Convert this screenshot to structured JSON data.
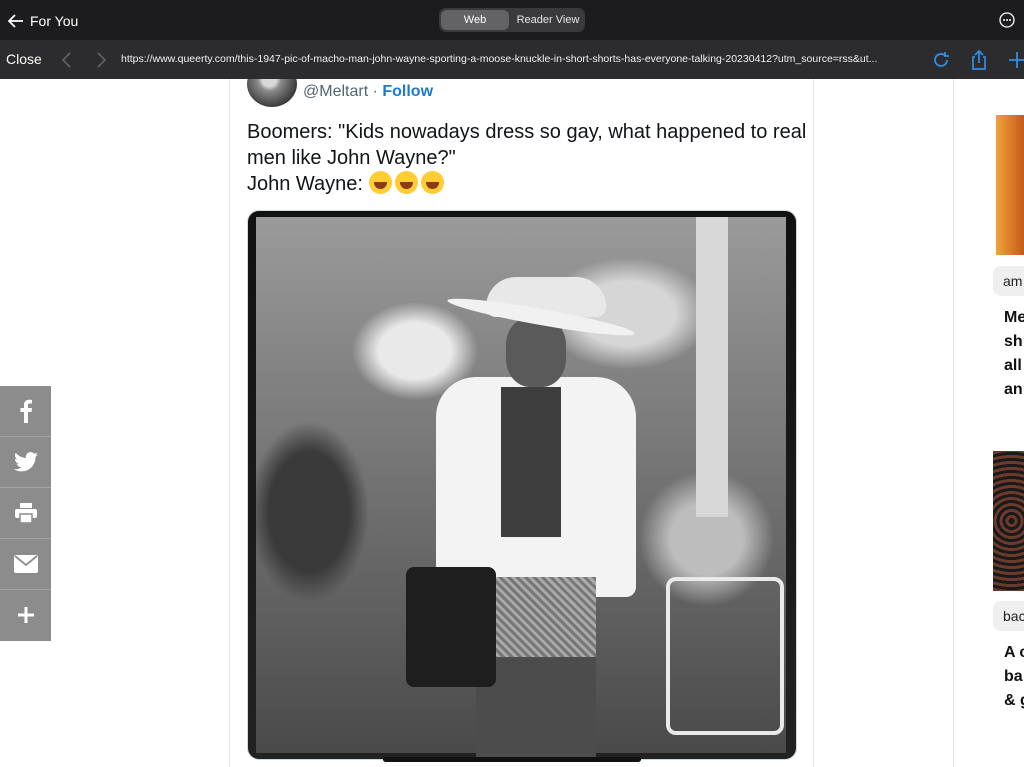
{
  "topbar": {
    "back_label": "For You",
    "segment": {
      "web": "Web",
      "reader": "Reader View",
      "selected": "Web"
    }
  },
  "address": {
    "close_label": "Close",
    "url": "https://www.queerty.com/this-1947-pic-of-macho-man-john-wayne-sporting-a-moose-knuckle-in-short-shorts-has-everyone-talking-20230412?utm_source=rss&ut..."
  },
  "tweet": {
    "handle": "@Meltart",
    "separator": " · ",
    "follow_label": "Follow",
    "line1": "Boomers: \"Kids nowadays dress so gay, what happened to real men like John Wayne?\"",
    "line2": "John Wayne:"
  },
  "sidebar_right": {
    "tag1": "am",
    "headline1": "Me\nsh\nall\nan",
    "tag2": "bac",
    "headline2": "A c\nba\n& g"
  },
  "share": {
    "items": [
      "facebook-icon",
      "twitter-icon",
      "print-icon",
      "email-icon",
      "plus-icon"
    ]
  },
  "colors": {
    "accent": "#1d79c9",
    "topbar": "#1c1c1e",
    "addressbar": "#2c2c2e",
    "share": "#8c8c8c"
  }
}
